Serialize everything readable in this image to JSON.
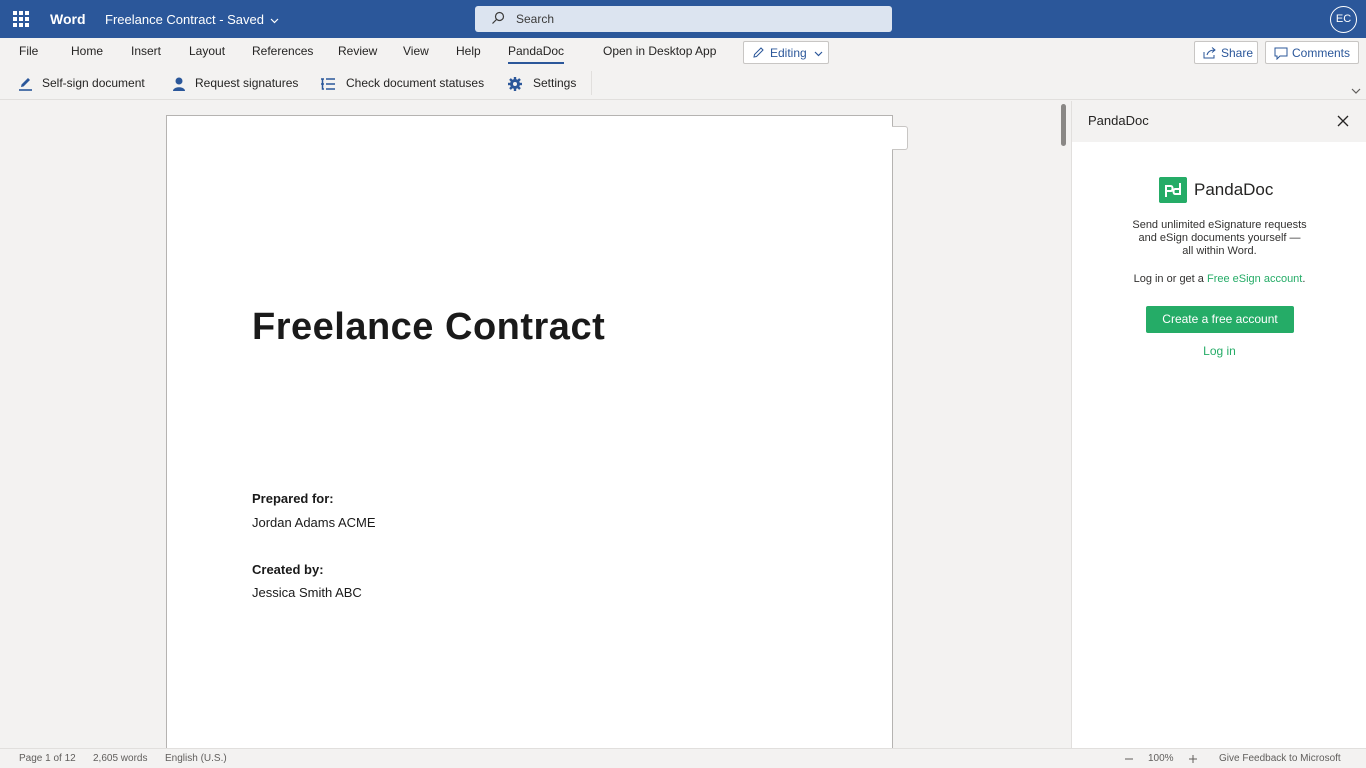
{
  "titlebar": {
    "app_name": "Word",
    "doc_name": "Freelance Contract",
    "doc_state": "Saved",
    "search_placeholder": "Search",
    "avatar_initials": "EC"
  },
  "menu": {
    "items": [
      "File",
      "Home",
      "Insert",
      "Layout",
      "References",
      "Review",
      "View",
      "Help",
      "PandaDoc",
      "Open in Desktop App"
    ],
    "active": "PandaDoc",
    "editing_label": "Editing",
    "share_label": "Share",
    "comments_label": "Comments"
  },
  "ribbon": {
    "items": [
      {
        "label": "Self-sign document",
        "icon": "pen-icon"
      },
      {
        "label": "Request signatures",
        "icon": "person-icon"
      },
      {
        "label": "Check document statuses",
        "icon": "list-icon"
      },
      {
        "label": "Settings",
        "icon": "gear-icon"
      }
    ]
  },
  "document": {
    "title": "Freelance Contract",
    "prepared_for_label": "Prepared for:",
    "prepared_for_value": "Jordan Adams ACME",
    "created_by_label": "Created by:",
    "created_by_value": "Jessica Smith ABC"
  },
  "pane": {
    "title": "PandaDoc",
    "brand": "PandaDoc",
    "desc_lines": [
      "Send unlimited eSignature requests",
      "and eSign documents yourself —",
      "all within Word."
    ],
    "login_prefix": "Log in or get a ",
    "login_link": "Free eSign account",
    "login_suffix": ".",
    "create_button": "Create a free account",
    "login_button": "Log in"
  },
  "status": {
    "page": "Page 1 of 12",
    "words": "2,605 words",
    "language": "English (U.S.)",
    "zoom": "100%",
    "feedback": "Give Feedback to Microsoft"
  },
  "colors": {
    "word_blue": "#2b579a",
    "pandadoc_green": "#25ac67"
  }
}
